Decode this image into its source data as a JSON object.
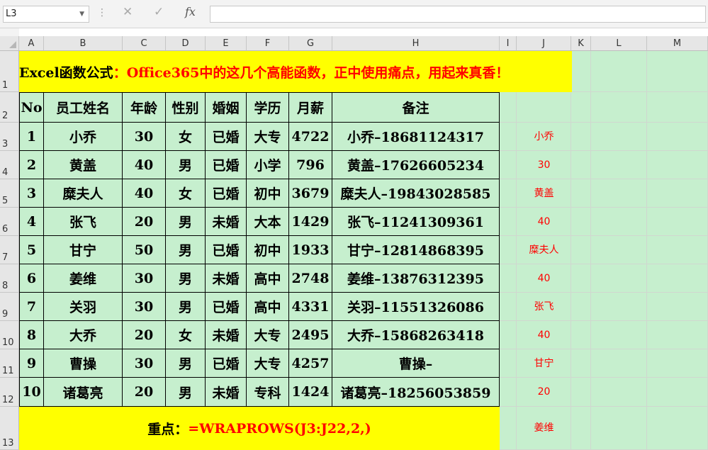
{
  "name_box": "L3",
  "formula_bar": {
    "cancel_icon": "✕",
    "enter_icon": "✓",
    "fx_label": "fx",
    "content": ""
  },
  "columns": [
    "A",
    "B",
    "C",
    "D",
    "E",
    "F",
    "G",
    "H",
    "I",
    "J",
    "K",
    "L",
    "M"
  ],
  "rows": [
    "1",
    "2",
    "3",
    "4",
    "5",
    "6",
    "7",
    "8",
    "9",
    "10",
    "11",
    "12",
    "13"
  ],
  "title": {
    "prefix": "Excel函数公式",
    "suffix": "：Office365中的这几个高能函数，正中使用痛点，用起来真香！",
    "prefix_color": "#000000",
    "suffix_color": "#ff0000"
  },
  "table": {
    "headers": [
      "No",
      "员工姓名",
      "年龄",
      "性别",
      "婚姻",
      "学历",
      "月薪",
      "备注"
    ],
    "rows": [
      [
        "1",
        "小乔",
        "30",
        "女",
        "已婚",
        "大专",
        "4722",
        "小乔–18681124317"
      ],
      [
        "2",
        "黄盖",
        "40",
        "男",
        "已婚",
        "小学",
        "796",
        "黄盖–17626605234"
      ],
      [
        "3",
        "糜夫人",
        "40",
        "女",
        "已婚",
        "初中",
        "3679",
        "糜夫人–19843028585"
      ],
      [
        "4",
        "张飞",
        "20",
        "男",
        "未婚",
        "大本",
        "1429",
        "张飞–11241309361"
      ],
      [
        "5",
        "甘宁",
        "50",
        "男",
        "已婚",
        "初中",
        "1933",
        "甘宁–12814868395"
      ],
      [
        "6",
        "姜维",
        "30",
        "男",
        "未婚",
        "高中",
        "2748",
        "姜维–13876312395"
      ],
      [
        "7",
        "关羽",
        "30",
        "男",
        "已婚",
        "高中",
        "4331",
        "关羽–11551326086"
      ],
      [
        "8",
        "大乔",
        "20",
        "女",
        "未婚",
        "大专",
        "2495",
        "大乔–15868263418"
      ],
      [
        "9",
        "曹操",
        "30",
        "男",
        "已婚",
        "大专",
        "4257",
        "曹操–"
      ],
      [
        "10",
        "诸葛亮",
        "20",
        "男",
        "未婚",
        "专科",
        "1424",
        "诸葛亮–18256053859"
      ]
    ]
  },
  "footer": {
    "label": "重点：",
    "formula": "=WRAPROWS(J3:J22,2,)",
    "label_color": "#000000",
    "formula_color": "#ff0000"
  },
  "column_j": [
    "小乔",
    "30",
    "黄盖",
    "40",
    "糜夫人",
    "40",
    "张飞",
    "40",
    "甘宁",
    "20",
    "姜维"
  ],
  "colors": {
    "green_fill": "#c6efce",
    "yellow_fill": "#ffff00",
    "red_text": "#ff0000"
  }
}
